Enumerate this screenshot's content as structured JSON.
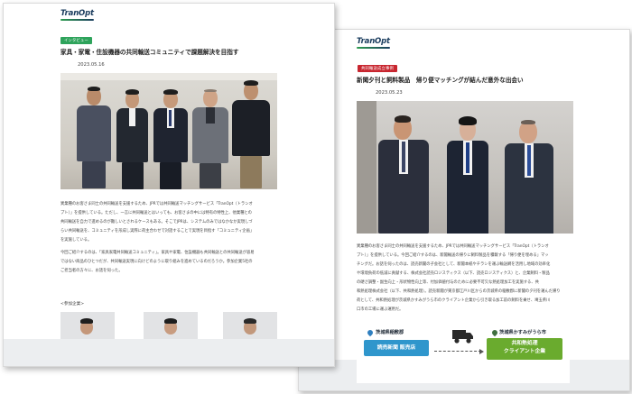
{
  "left_article": {
    "logo": "TranOpt",
    "category": "インタビュー",
    "category_color": "#2ea35b",
    "title": "家具・家電・住設機器の共同輸送コミュニティで課題解決を目指す",
    "date": "2023.05.16",
    "paragraphs": [
      [
        "異業種のお客さま同士の共同輸送を支援するため、JPRでは共同輸送マッチングサービス「TranOpt（トランオ",
        "プト）」を提供している。ただし、一言に共同輸送とはいっても、お客さまの中には特有の特性上、他業種との",
        "共同輸送を自力で進めるのが難しいとされるケースもある。そこでJPRは、システムのみではなかなか実現しづ",
        "らい共同輸送を、コミュニティを形成し実際に荷主合わせで対話することで実現を目指す「コミュニティ企画」",
        "を実施している。"
      ],
      [
        "今回ご紹介するのは、「家具家電共同輸送コミュニティ」。家具や家電、住設機器も共同輸送との共同輸送が容易",
        "ではない商品のひとつだが、共同輸送実現に向けどのように取り組みを進めているのだろうか。参加企業5社の",
        "ご担当者の方々に、お話を伺った。"
      ]
    ],
    "partners_label": "<参加企業>"
  },
  "right_article": {
    "logo": "TranOpt",
    "category": "共同輸送成立事例",
    "category_color": "#c8262f",
    "title": "新聞夕刊と飼料製品　帰り便マッチングが結んだ意外な出会い",
    "date": "2023.05.23",
    "paragraphs": [
      [
        "異業種のお客さま同士の共同輸送を支援するため、JPRでは共同輸送マッチングサービス「TranOpt（トランオ",
        "プト）」を提供している。今回ご紹介するのは、新聞輸送の帰りに飼料製品を積載する「帰り便を埋める」マッ",
        "チングだ。お話を伺ったのは、読売新聞の子会社として、新聞本紙やチラシを運ぶ輸送網を活用し地域の効率化",
        "や環境負荷の低減に貢献する、株式会社読売ロジスティクス（以下、読売ロジスティクス）と、企業飼料・製品",
        "の硬さ調整・副生向上・形状物性向上等、付加価値付与のために必要不可欠な熱処理加工を実施する、共",
        "和熱処理株式会社（以下、共和熱処理）。読売新聞が東京都江戸川区からの茨城県の稲敷郡に新聞の夕刊を運んだ帰り",
        "荷として、共和熱処理が茨城県かすみがうら市のクライアント企業から引き取る加工前の飼料を乗せ、埼玉県川",
        "口市の工場に運ぶ運用だ。"
      ]
    ],
    "diagram": {
      "origin_place": "茨城県稲敷郡",
      "origin_company": "読売新聞 販売店",
      "origin_color": "#2f96cc",
      "dest_place": "茨城県かすみがうら市",
      "dest_company_line1": "共和熱処理",
      "dest_company_line2": "クライアント企業",
      "dest_color": "#6aab2e",
      "truck_icon": "truck-icon"
    }
  }
}
